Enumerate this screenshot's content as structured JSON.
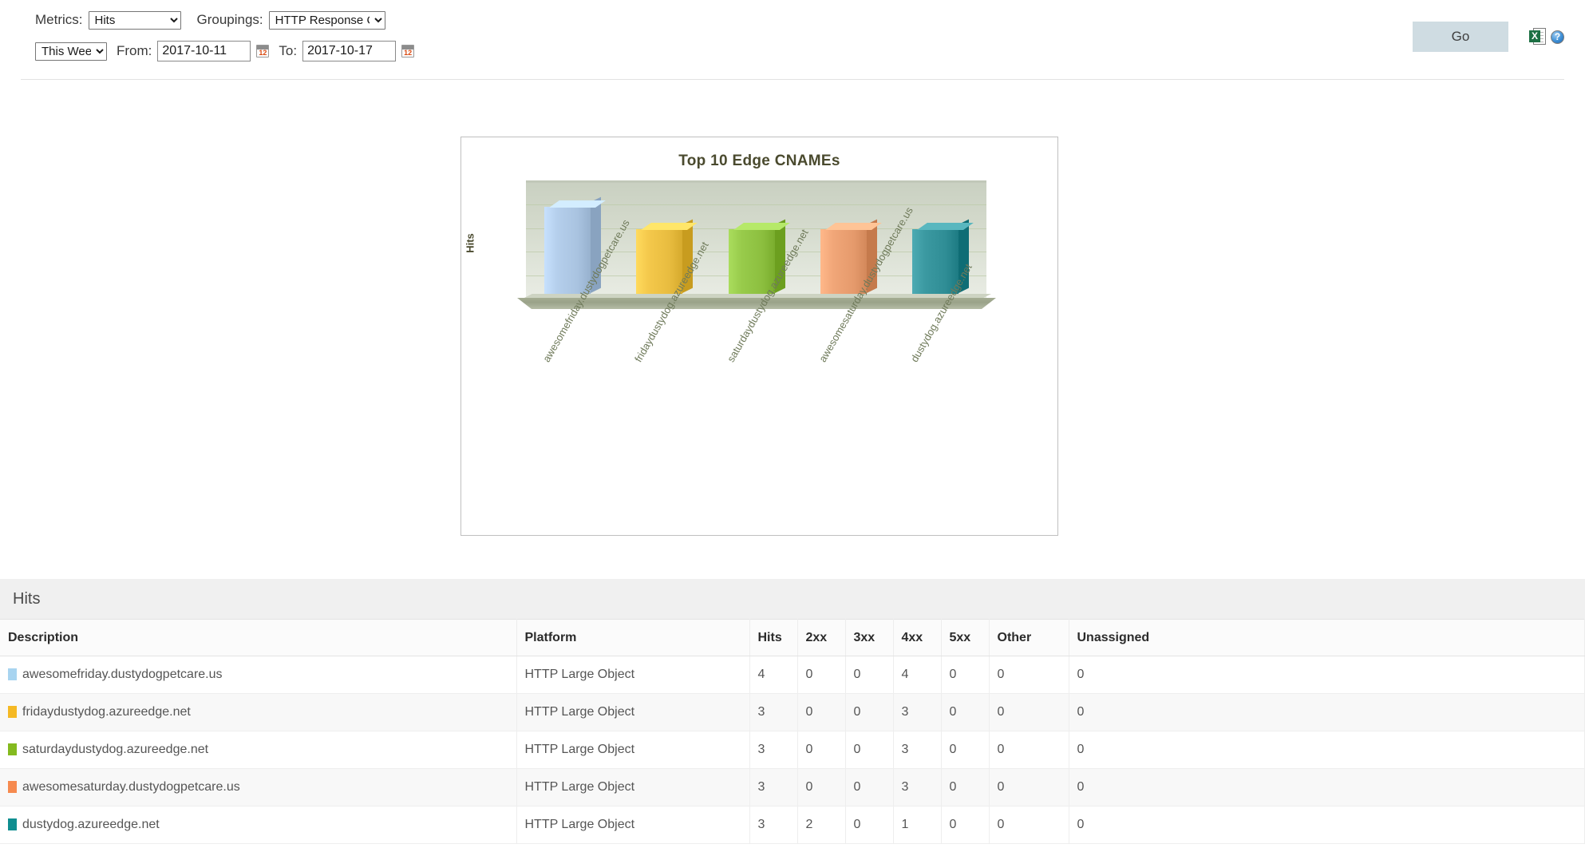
{
  "toolbar": {
    "metrics_label": "Metrics:",
    "metrics_value": "Hits",
    "metrics_options": [
      "Hits"
    ],
    "groupings_label": "Groupings:",
    "groupings_value": "HTTP Response Codes",
    "groupings_options": [
      "HTTP Response Codes"
    ],
    "range_value": "This Week",
    "range_options": [
      "This Week"
    ],
    "from_label": "From:",
    "from_value": "2017-10-11",
    "to_label": "To:",
    "to_value": "2017-10-17",
    "go_label": "Go",
    "calendar_icon": "calendar-icon",
    "excel_icon": "excel-export-icon",
    "excel_badge": "X",
    "help_icon": "help-icon",
    "help_glyph": "?"
  },
  "chart_data": {
    "type": "bar",
    "title": "Top 10 Edge CNAMEs",
    "xlabel": "",
    "ylabel": "Hits",
    "ylim": [
      0,
      5
    ],
    "grid": true,
    "gridline_count": 5,
    "legend": "none",
    "categories": [
      "awesomefriday.dustydogpetcare.us",
      "fridaydustydog.azureedge.net",
      "saturdaydustydog.azureedge.net",
      "awesomesaturday.dustydogpetcare.us",
      "dustydog.azureedge.net"
    ],
    "values": [
      4,
      3,
      3,
      3,
      3
    ],
    "colors": [
      "#a9c3e0",
      "#e8bc3f",
      "#8cbf3f",
      "#e59a6c",
      "#2f8d95"
    ]
  },
  "section": {
    "title": "Hits"
  },
  "table": {
    "columns": [
      "Description",
      "Platform",
      "Hits",
      "2xx",
      "3xx",
      "4xx",
      "5xx",
      "Other",
      "Unassigned"
    ],
    "rows": [
      {
        "swatch": "#a8d4f0",
        "description": "awesomefriday.dustydogpetcare.us",
        "platform": "HTTP Large Object",
        "hits": "4",
        "c2xx": "0",
        "c3xx": "0",
        "c4xx": "4",
        "c5xx": "0",
        "other": "0",
        "unassigned": "0"
      },
      {
        "swatch": "#f5b924",
        "description": "fridaydustydog.azureedge.net",
        "platform": "HTTP Large Object",
        "hits": "3",
        "c2xx": "0",
        "c3xx": "0",
        "c4xx": "3",
        "c5xx": "0",
        "other": "0",
        "unassigned": "0"
      },
      {
        "swatch": "#84ba1f",
        "description": "saturdaydustydog.azureedge.net",
        "platform": "HTTP Large Object",
        "hits": "3",
        "c2xx": "0",
        "c3xx": "0",
        "c4xx": "3",
        "c5xx": "0",
        "other": "0",
        "unassigned": "0"
      },
      {
        "swatch": "#f68a4f",
        "description": "awesomesaturday.dustydogpetcare.us",
        "platform": "HTTP Large Object",
        "hits": "3",
        "c2xx": "0",
        "c3xx": "0",
        "c4xx": "3",
        "c5xx": "0",
        "other": "0",
        "unassigned": "0"
      },
      {
        "swatch": "#0f8e90",
        "description": "dustydog.azureedge.net",
        "platform": "HTTP Large Object",
        "hits": "3",
        "c2xx": "2",
        "c3xx": "0",
        "c4xx": "1",
        "c5xx": "0",
        "other": "0",
        "unassigned": "0"
      }
    ]
  }
}
